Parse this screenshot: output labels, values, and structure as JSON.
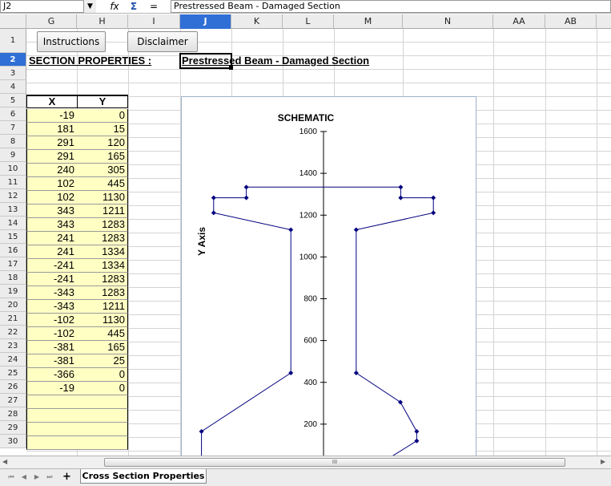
{
  "formula_bar": {
    "name_box": "J2",
    "formula": "Prestressed Beam - Damaged Section"
  },
  "columns": [
    {
      "label": "G",
      "w": 0
    },
    {
      "label": "H"
    },
    {
      "label": "I"
    },
    {
      "label": "J"
    },
    {
      "label": "K"
    },
    {
      "label": "L"
    },
    {
      "label": "M"
    },
    {
      "label": "N"
    },
    {
      "label": "AA"
    },
    {
      "label": "AB"
    }
  ],
  "selected_column": "J",
  "rows": [
    "1",
    "2",
    "3",
    "4",
    "5",
    "6",
    "7",
    "8",
    "9",
    "10",
    "11",
    "12",
    "13",
    "14",
    "15",
    "16",
    "17",
    "18",
    "19",
    "20",
    "21",
    "22",
    "23",
    "24",
    "25",
    "26",
    "27",
    "28",
    "29",
    "30"
  ],
  "selected_row": "2",
  "buttons": {
    "instructions": "Instructions",
    "disclaimer": "Disclaimer"
  },
  "headers": {
    "section_properties": "SECTION PROPERTIES :",
    "title": "Prestressed Beam - Damaged Section"
  },
  "table": {
    "col_x": "X",
    "col_y": "Y",
    "rows": [
      [
        "-19",
        "0"
      ],
      [
        "181",
        "15"
      ],
      [
        "291",
        "120"
      ],
      [
        "291",
        "165"
      ],
      [
        "240",
        "305"
      ],
      [
        "102",
        "445"
      ],
      [
        "102",
        "1130"
      ],
      [
        "343",
        "1211"
      ],
      [
        "343",
        "1283"
      ],
      [
        "241",
        "1283"
      ],
      [
        "241",
        "1334"
      ],
      [
        "-241",
        "1334"
      ],
      [
        "-241",
        "1283"
      ],
      [
        "-343",
        "1283"
      ],
      [
        "-343",
        "1211"
      ],
      [
        "-102",
        "1130"
      ],
      [
        "-102",
        "445"
      ],
      [
        "-381",
        "165"
      ],
      [
        "-381",
        "25"
      ],
      [
        "-366",
        "0"
      ],
      [
        "-19",
        "0"
      ],
      [
        "",
        ""
      ],
      [
        "",
        ""
      ],
      [
        "",
        ""
      ],
      [
        "",
        ""
      ]
    ]
  },
  "chart_data": {
    "type": "line",
    "title": "SCHEMATIC",
    "ylabel": "Y Axis",
    "xlabel": "",
    "y_ticks": [
      "1600",
      "1400",
      "1200",
      "1000",
      "800",
      "600",
      "400",
      "200"
    ],
    "ylim": [
      0,
      1600
    ],
    "xlim": [
      -400,
      400
    ],
    "grid": false,
    "series": [
      {
        "x": [
          -19,
          181,
          291,
          291,
          240,
          102,
          102,
          343,
          343,
          241,
          241,
          -241,
          -241,
          -343,
          -343,
          -102,
          -102,
          -381,
          -381,
          -366,
          -19
        ],
        "y": [
          0,
          15,
          120,
          165,
          305,
          445,
          1130,
          1211,
          1283,
          1283,
          1334,
          1334,
          1283,
          1283,
          1211,
          1130,
          445,
          165,
          25,
          0,
          0
        ]
      }
    ],
    "line_color": "#00007f",
    "marker_color": "#00007f"
  },
  "sheet_tabs": {
    "active": "Cross Section Properties",
    "add_label": "+"
  },
  "scrollbar": {
    "grip": "III"
  },
  "colors": {
    "input_fill": "#ffffc4",
    "selection": "#2f6fd6"
  }
}
